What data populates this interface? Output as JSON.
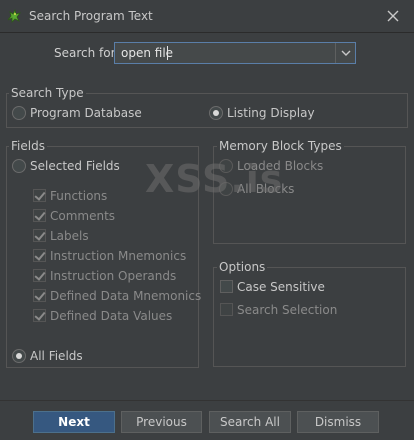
{
  "window": {
    "title": "Search Program Text"
  },
  "search": {
    "label": "Search for:",
    "value": "open file"
  },
  "search_type": {
    "title": "Search Type",
    "options": [
      {
        "label": "Program Database",
        "selected": false
      },
      {
        "label": "Listing Display",
        "selected": true
      }
    ]
  },
  "fields": {
    "title": "Fields",
    "selected_fields_label": "Selected Fields",
    "items": [
      {
        "label": "Functions",
        "checked": true
      },
      {
        "label": "Comments",
        "checked": true
      },
      {
        "label": "Labels",
        "checked": true
      },
      {
        "label": "Instruction Mnemonics",
        "checked": true
      },
      {
        "label": "Instruction Operands",
        "checked": true
      },
      {
        "label": "Defined Data Mnemonics",
        "checked": true
      },
      {
        "label": "Defined Data Values",
        "checked": true
      }
    ],
    "all_fields_label": "All Fields"
  },
  "memory": {
    "title": "Memory Block Types",
    "options": [
      {
        "label": "Loaded Blocks",
        "selected": false
      },
      {
        "label": "All Blocks",
        "selected": false
      }
    ]
  },
  "options": {
    "title": "Options",
    "case_sensitive": "Case Sensitive",
    "search_selection": "Search Selection"
  },
  "buttons": {
    "next": "Next",
    "previous": "Previous",
    "search_all": "Search All",
    "dismiss": "Dismiss"
  },
  "watermark": "XSS.is",
  "colors": {
    "accent": "#365880",
    "background": "#3c3f41",
    "focus_border": "#5a7ea8"
  },
  "icons": {
    "app": "dragon-icon",
    "close": "close-icon",
    "dropdown": "chevron-down-icon"
  }
}
